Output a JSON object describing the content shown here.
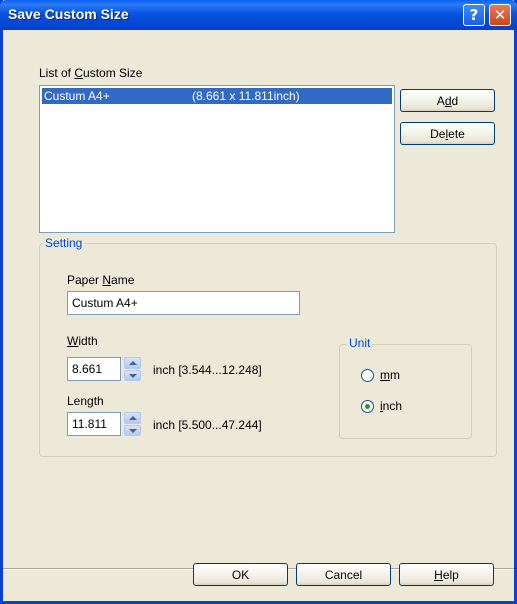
{
  "window": {
    "title": "Save Custom Size"
  },
  "list": {
    "label_pre": "List of ",
    "label_mnemonic": "C",
    "label_post": "ustom Size",
    "items": [
      {
        "name": "Custum A4+",
        "dims": "(8.661 x 11.811inch)"
      }
    ]
  },
  "buttons": {
    "add_pre": "A",
    "add_mnemonic": "d",
    "add_post": "d",
    "delete_pre": "De",
    "delete_mnemonic": "l",
    "delete_post": "ete",
    "ok": "OK",
    "cancel": "Cancel",
    "help_mnemonic": "H",
    "help_post": "elp"
  },
  "setting": {
    "title": "Setting",
    "paper_name_pre": "Paper ",
    "paper_name_mnemonic": "N",
    "paper_name_post": "ame",
    "paper_name_value": "Custum A4+",
    "width_mnemonic": "W",
    "width_post": "idth",
    "width_value": "8.661",
    "width_range": "inch [3.544...12.248]",
    "length_pre": "Len",
    "length_mnemonic": "g",
    "length_post": "th",
    "length_value": "11.811",
    "length_range": "inch [5.500...47.244]"
  },
  "unit": {
    "title": "Unit",
    "mm_mnemonic": "m",
    "mm_post": "m",
    "inch_mnemonic": "i",
    "inch_post": "nch",
    "selected": "inch"
  }
}
